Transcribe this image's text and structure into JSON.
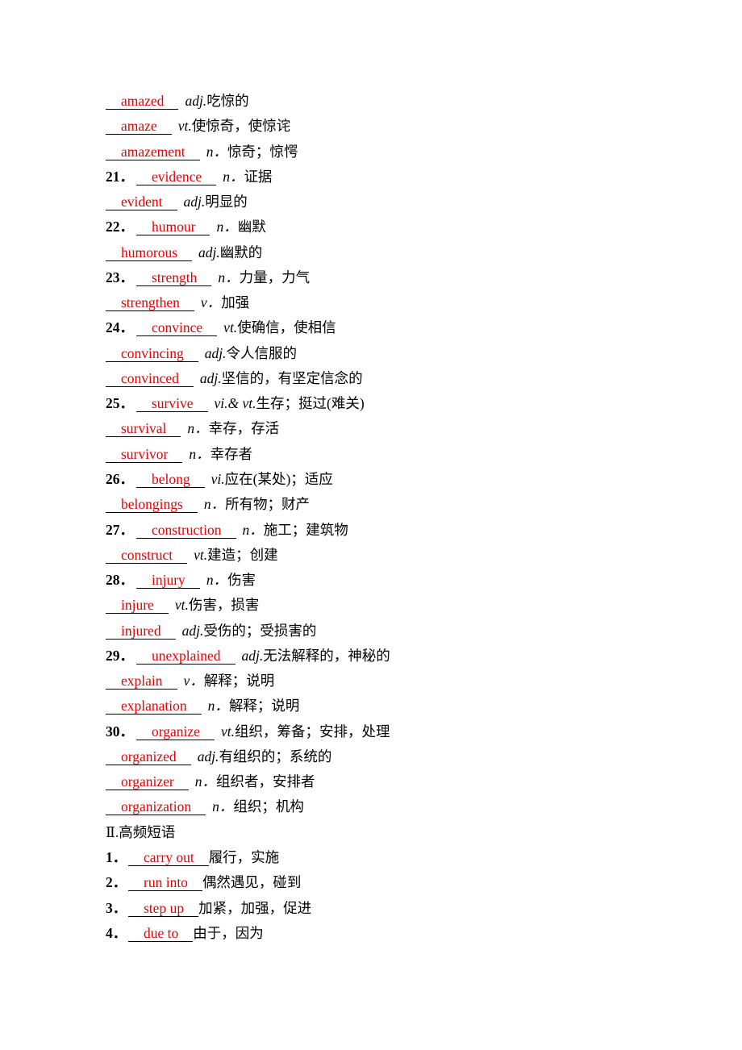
{
  "entries": [
    {
      "num": "",
      "answer": "amazed",
      "pos": "adj.",
      "def": "吃惊的"
    },
    {
      "num": "",
      "answer": "amaze",
      "pos": "vt.",
      "def": "使惊奇，使惊诧"
    },
    {
      "num": "",
      "answer": "amazement",
      "pos": "n．",
      "def": "惊奇；惊愕"
    },
    {
      "num": "21．",
      "answer": "evidence",
      "pos": "n．",
      "def": "证据"
    },
    {
      "num": "",
      "answer": "evident",
      "pos": "adj.",
      "def": "明显的"
    },
    {
      "num": "22．",
      "answer": "humour",
      "pos": "n．",
      "def": "幽默"
    },
    {
      "num": "",
      "answer": "humorous",
      "pos": "adj.",
      "def": "幽默的"
    },
    {
      "num": "23．",
      "answer": "strength",
      "pos": "n．",
      "def": "力量，力气"
    },
    {
      "num": "",
      "answer": "strengthen",
      "pos": "v．",
      "def": "加强"
    },
    {
      "num": "24．",
      "answer": "convince",
      "pos": "vt.",
      "def": "使确信，使相信"
    },
    {
      "num": "",
      "answer": "convincing",
      "pos": "adj.",
      "def": "令人信服的"
    },
    {
      "num": "",
      "answer": "convinced",
      "pos": "adj.",
      "def": "坚信的，有坚定信念的"
    },
    {
      "num": "25．",
      "answer": "survive",
      "pos": "vi.& vt.",
      "def": "生存；挺过(难关)"
    },
    {
      "num": "",
      "answer": "survival",
      "pos": "n．",
      "def": "幸存，存活"
    },
    {
      "num": "",
      "answer": "survivor",
      "pos": "n．",
      "def": "幸存者"
    },
    {
      "num": "26．",
      "answer": "belong",
      "pos": "vi.",
      "def": "应在(某处)；适应"
    },
    {
      "num": "",
      "answer": "belongings",
      "pos": "n．",
      "def": "所有物；财产"
    },
    {
      "num": "27．",
      "answer": "construction",
      "pos": "n．",
      "def": "施工；建筑物"
    },
    {
      "num": "",
      "answer": "construct",
      "pos": "vt.",
      "def": "建造；创建"
    },
    {
      "num": "28．",
      "answer": "injury",
      "pos": "n．",
      "def": "伤害"
    },
    {
      "num": "",
      "answer": "injure",
      "pos": "vt.",
      "def": "伤害，损害"
    },
    {
      "num": "",
      "answer": "injured",
      "pos": "adj.",
      "def": "受伤的；受损害的"
    },
    {
      "num": "29．",
      "answer": "unexplained",
      "pos": "adj.",
      "def": "无法解释的，神秘的"
    },
    {
      "num": "",
      "answer": "explain",
      "pos": "v．",
      "def": "解释；说明"
    },
    {
      "num": "",
      "answer": "explanation",
      "pos": "n．",
      "def": "解释；说明"
    },
    {
      "num": "30．",
      "answer": "organize",
      "pos": "vt.",
      "def": "组织，筹备；安排，处理"
    },
    {
      "num": "",
      "answer": "organized",
      "pos": "adj.",
      "def": "有组织的；系统的"
    },
    {
      "num": "",
      "answer": "organizer",
      "pos": "n．",
      "def": "组织者，安排者"
    },
    {
      "num": "",
      "answer": "organization",
      "pos": "n．",
      "def": "组织；机构"
    }
  ],
  "section_heading": "Ⅱ.高频短语",
  "phrases": [
    {
      "num": "1．",
      "answer": "carry out",
      "def": "履行，实施"
    },
    {
      "num": "2．",
      "answer": "run into",
      "def": "偶然遇见，碰到"
    },
    {
      "num": "3．",
      "answer": "step up",
      "def": "加紧，加强，促进"
    },
    {
      "num": "4．",
      "answer": "due to",
      "def": "由于，因为"
    }
  ],
  "colors": {
    "answer": "#ff0000",
    "text": "#000000"
  }
}
